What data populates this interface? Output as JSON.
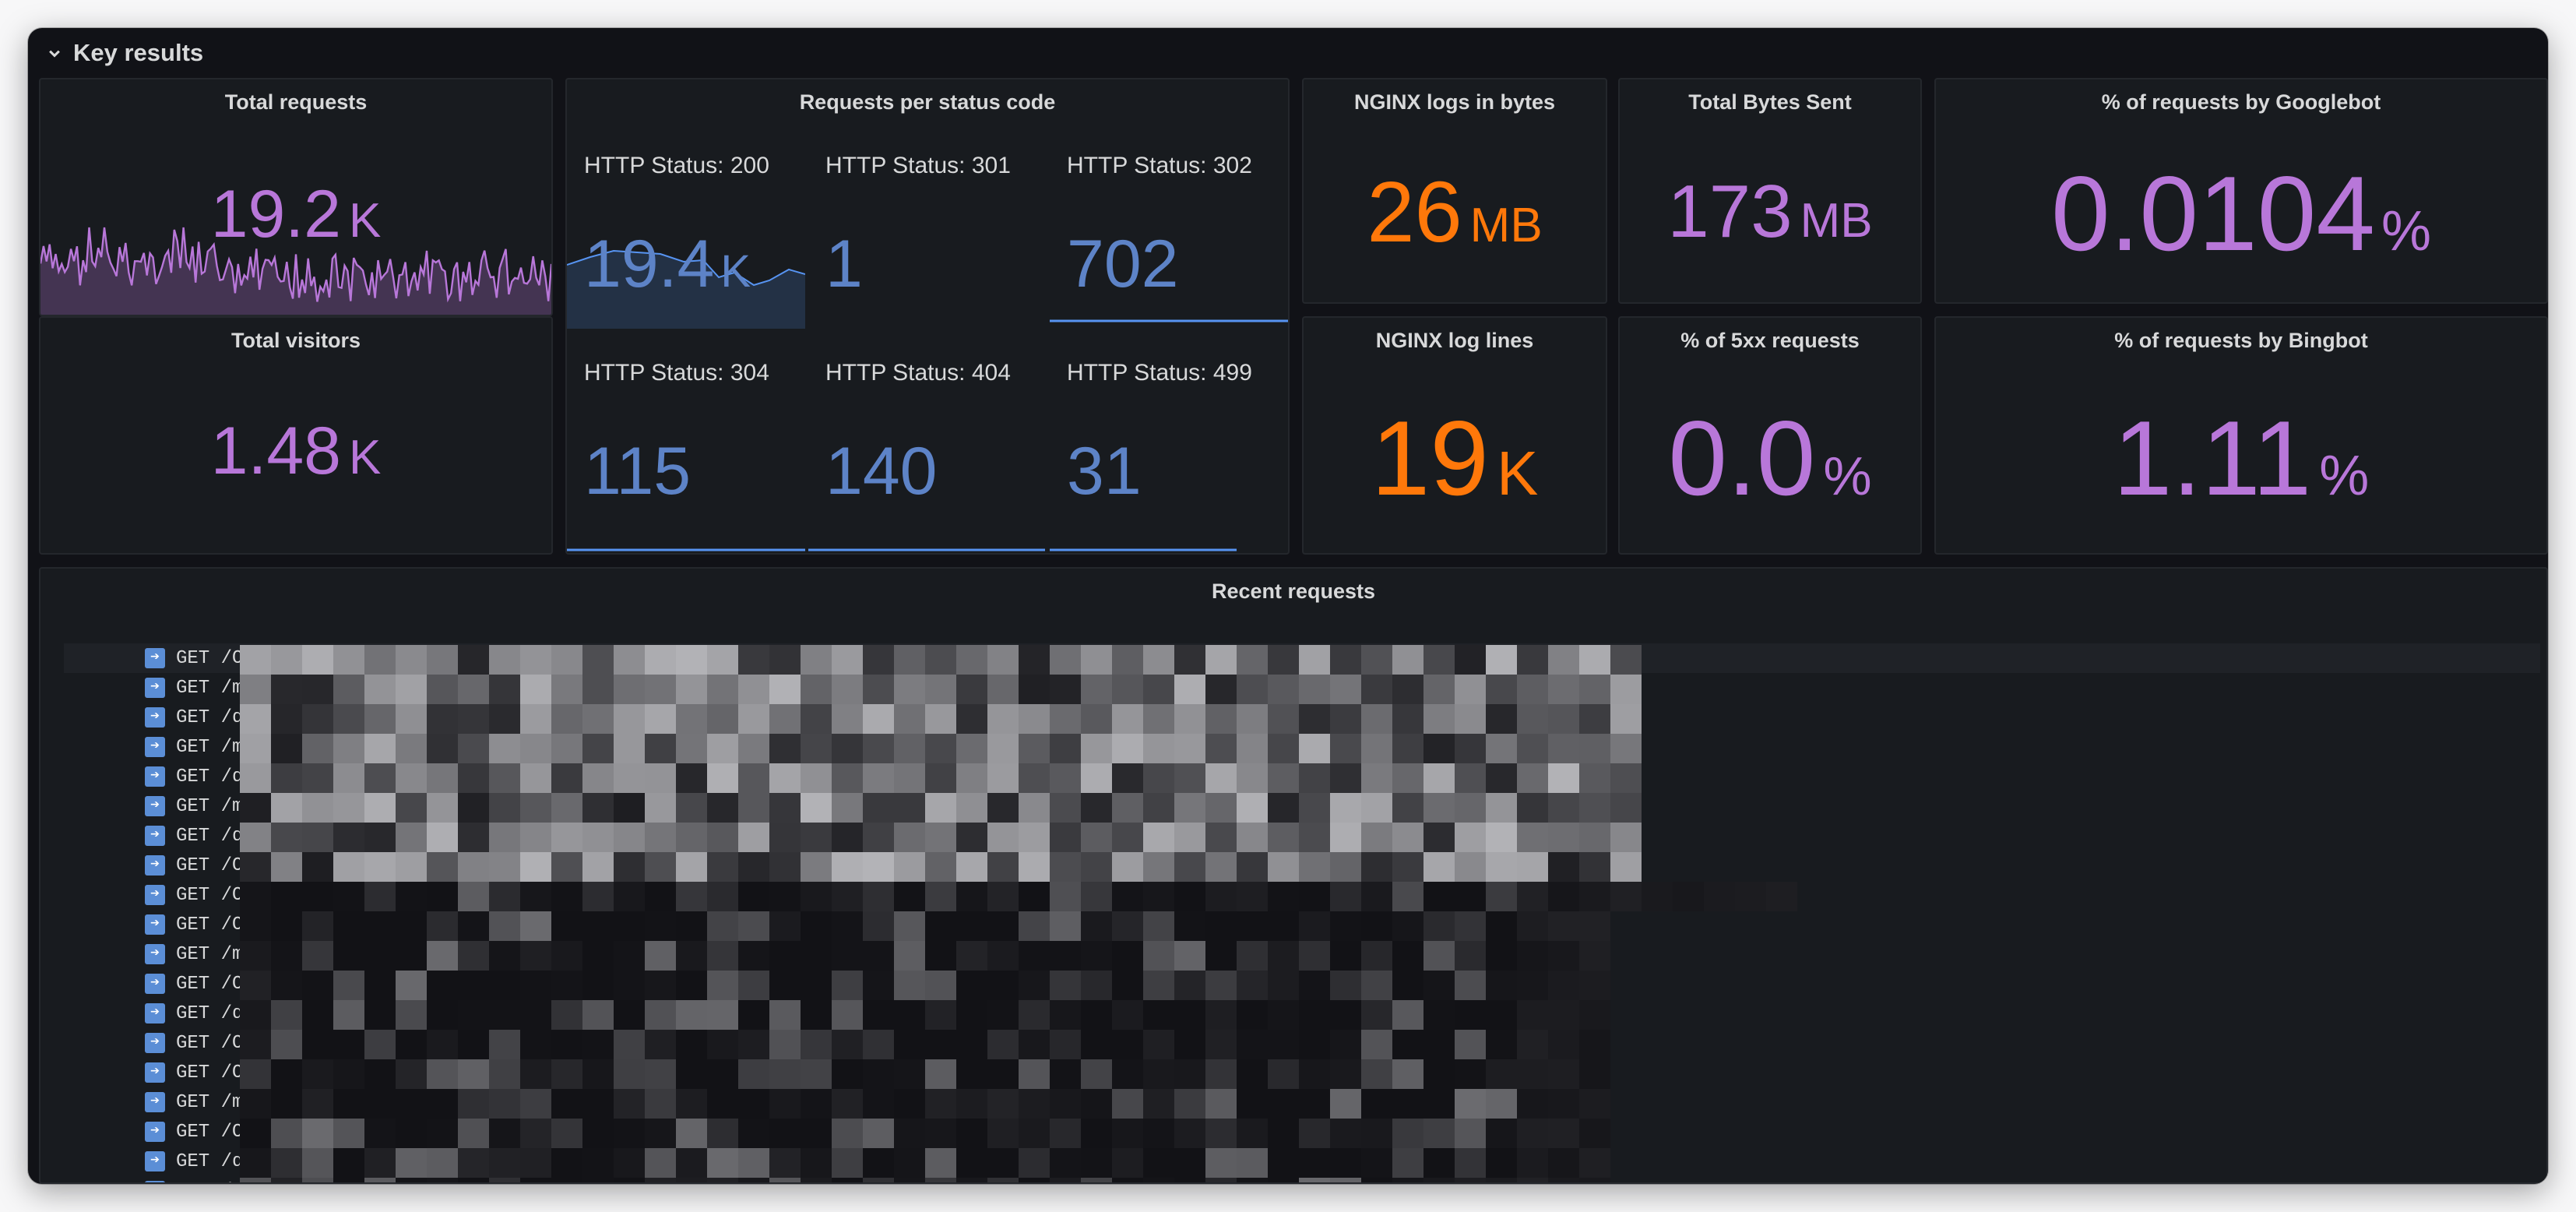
{
  "row": {
    "title": "Key results"
  },
  "panels": {
    "total_requests": {
      "title": "Total requests",
      "value": "19.2",
      "unit": "K"
    },
    "total_visitors": {
      "title": "Total visitors",
      "value": "1.48",
      "unit": "K"
    },
    "status_codes": {
      "title": "Requests per status code",
      "items": [
        {
          "label": "HTTP Status: 200",
          "value": "19.4",
          "unit": "K"
        },
        {
          "label": "HTTP Status: 301",
          "value": "1",
          "unit": ""
        },
        {
          "label": "HTTP Status: 302",
          "value": "702",
          "unit": ""
        },
        {
          "label": "HTTP Status: 304",
          "value": "115",
          "unit": ""
        },
        {
          "label": "HTTP Status: 404",
          "value": "140",
          "unit": ""
        },
        {
          "label": "HTTP Status: 499",
          "value": "31",
          "unit": ""
        }
      ]
    },
    "nginx_bytes": {
      "title": "NGINX logs in bytes",
      "value": "26",
      "unit": "MB"
    },
    "bytes_sent": {
      "title": "Total Bytes Sent",
      "value": "173",
      "unit": "MB"
    },
    "googlebot": {
      "title": "% of requests by Googlebot",
      "value": "0.0104",
      "unit": "%"
    },
    "log_lines": {
      "title": "NGINX log lines",
      "value": "19",
      "unit": "K"
    },
    "five_xx": {
      "title": "% of 5xx requests",
      "value": "0.0",
      "unit": "%"
    },
    "bingbot": {
      "title": "% of requests by Bingbot",
      "value": "1.11",
      "unit": "%"
    }
  },
  "recent": {
    "title": "Recent requests",
    "rows": [
      "GET /OJ/",
      "GET /met",
      "GET /dom",
      "GET /met",
      "GET /dom",
      "GET /met",
      "GET /dom",
      "GET /OJ/",
      "GET /OJ/",
      "GET /OJ/",
      "GET /met",
      "GET /OJ/",
      "GET /dom",
      "GET /OJ/",
      "GET /OJ/",
      "GET /met",
      "GET /OJ/",
      "GET /dom",
      "GET /OJ/"
    ]
  },
  "colors": {
    "purple": "#b877d9",
    "orange": "#ff780a",
    "blue": "#5794f2",
    "panel_bg": "#181b1f"
  }
}
